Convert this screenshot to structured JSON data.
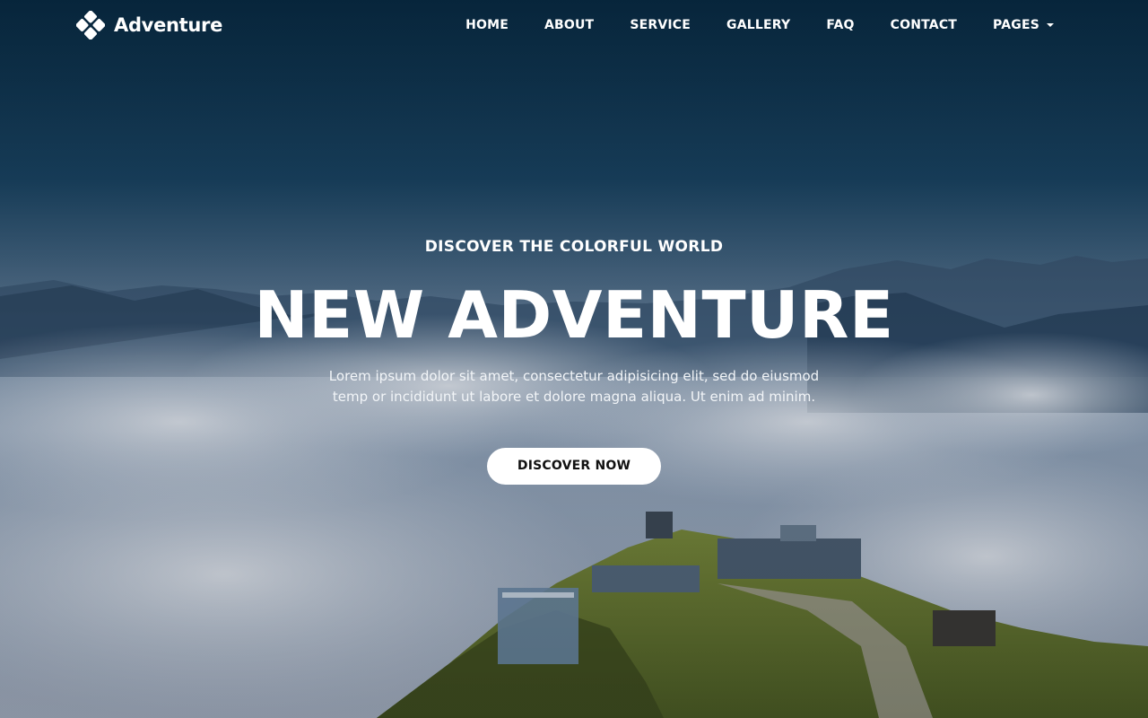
{
  "brand": {
    "name": "Adventure",
    "icon": "diamond-cluster-icon"
  },
  "nav": {
    "items": [
      {
        "label": "HOME"
      },
      {
        "label": "ABOUT"
      },
      {
        "label": "SERVICE"
      },
      {
        "label": "GALLERY"
      },
      {
        "label": "FAQ"
      },
      {
        "label": "CONTACT"
      },
      {
        "label": "PAGES",
        "has_dropdown": true
      }
    ]
  },
  "hero": {
    "eyebrow": "DISCOVER THE COLORFUL WORLD",
    "headline": "NEW ADVENTURE",
    "lede": "Lorem ipsum dolor sit amet, consectetur adipisicing elit, sed do eiusmod temp or incididunt ut labore et dolore magna aliqua. Ut enim ad minim.",
    "cta_label": "DISCOVER NOW"
  },
  "colors": {
    "sky_top": "#0b3a5c",
    "text": "#ffffff",
    "button_bg": "#ffffff",
    "button_text": "#111111"
  }
}
